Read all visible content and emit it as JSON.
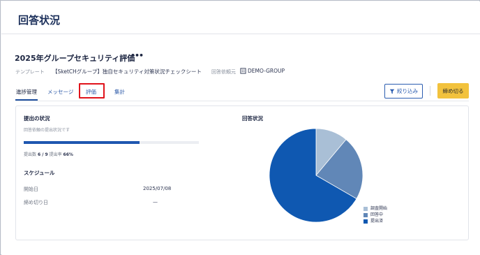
{
  "page": {
    "title": "回答状況"
  },
  "survey": {
    "title": "2025年グループセキュリティ評価",
    "more_icon": "•••",
    "template_label": "テンプレート",
    "template_value": "【SketCHグループ】独自セキュリティ対策状況チェックシート",
    "requester_label": "回答依頼元",
    "requester_icon": "building-icon",
    "requester_value": "DEMO-GROUP"
  },
  "tabs": [
    {
      "label": "進捗管理",
      "active": true
    },
    {
      "label": "メッセージ",
      "active": false
    },
    {
      "label": "評価",
      "active": false,
      "highlighted": true
    },
    {
      "label": "集計",
      "active": false
    }
  ],
  "toolbar": {
    "filter_label": "絞り込み",
    "filter_icon": "filter-icon",
    "close_label": "締め切る"
  },
  "submission": {
    "title": "提出の状況",
    "subtitle": "回答依頼の提出状況です",
    "progress": 0.66,
    "count_label": "提出数",
    "count_value": "6 / 9",
    "rate_label": "提出率",
    "rate_value": "66%"
  },
  "schedule": {
    "title": "スケジュール",
    "start_label": "開始日",
    "start_value": "2025/07/08",
    "deadline_label": "締め切り日",
    "deadline_value": "—"
  },
  "response_status": {
    "title": "回答状況"
  },
  "colors": {
    "accent": "#1f57b0",
    "highlight_box": "#e0131b",
    "close_button": "#f2c23d",
    "slice_not_started": "#a9bfd6",
    "slice_in_progress": "#6187b7",
    "slice_submitted": "#0f58b1"
  },
  "chart_data": {
    "type": "pie",
    "title": "回答状況",
    "categories": [
      "調査開始",
      "回答中",
      "提出済"
    ],
    "values": [
      1,
      2,
      6
    ],
    "colors": [
      "#a9bfd6",
      "#6187b7",
      "#0f58b1"
    ],
    "legend": "bottom-right"
  }
}
